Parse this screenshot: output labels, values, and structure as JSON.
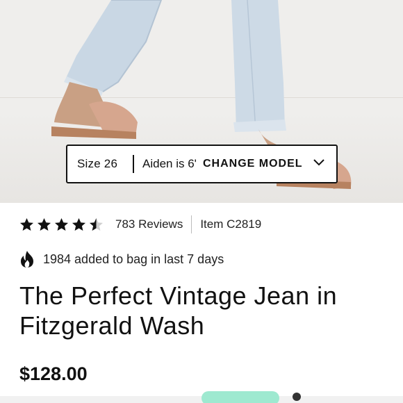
{
  "model_info": {
    "size": "Size 26",
    "height": "Aiden is 6'",
    "change_model_label": "CHANGE MODEL"
  },
  "rating": {
    "stars": 4.5,
    "out_of": 5,
    "reviews": "783 Reviews",
    "item_number": "Item C2819"
  },
  "social_proof": {
    "text": "1984 added to bag in last 7 days",
    "icon": "fire-icon"
  },
  "product": {
    "title": "The Perfect Vintage Jean in Fitzgerald Wash",
    "price": "$128.00"
  },
  "colors": {
    "accent_mint": "#9ee9d0",
    "text": "#111111",
    "star_filled": "#111111",
    "star_empty": "#cfcfcf"
  }
}
